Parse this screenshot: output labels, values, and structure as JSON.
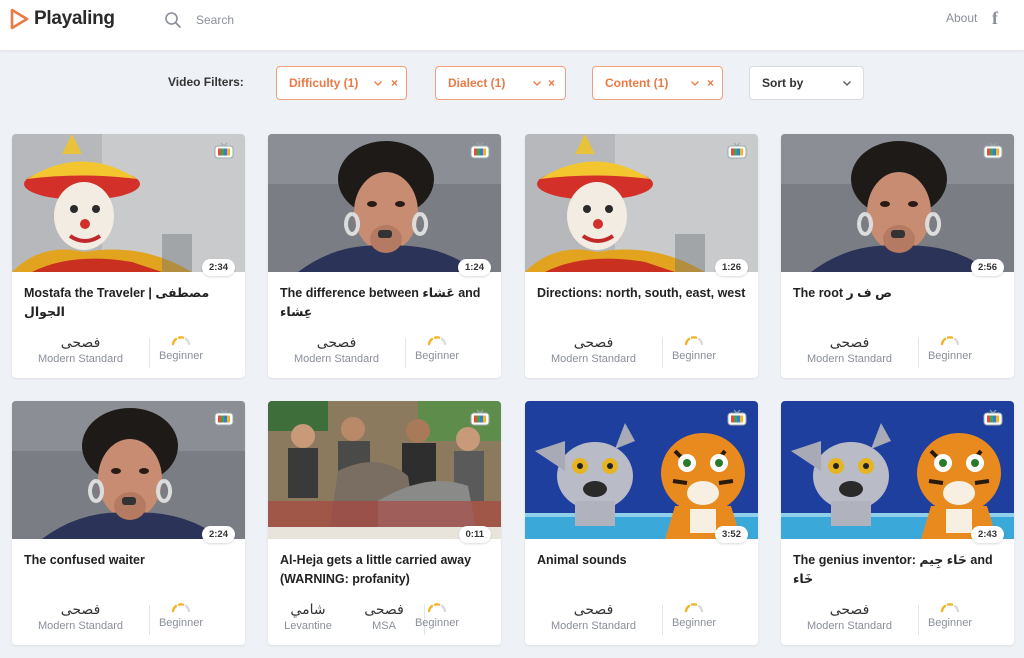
{
  "header": {
    "brand": "Playaling",
    "search_placeholder": "Search",
    "about_label": "About",
    "facebook_icon": "f"
  },
  "filters": {
    "label": "Video Filters:",
    "difficulty": "Difficulty (1)",
    "dialect": "Dialect (1)",
    "content": "Content (1)",
    "sort": "Sort by",
    "clear_glyph": "×"
  },
  "colors": {
    "accent": "#e97a45",
    "background": "#eef1f6"
  },
  "videos": [
    {
      "title": "Mostafa the Traveler | مصطفى الجوال",
      "duration": "2:34",
      "thumbnail": "clown",
      "dialects": [
        {
          "ar": "فصحى",
          "en": "Modern Standard"
        }
      ],
      "level": "Beginner"
    },
    {
      "title": "The difference between عَشاء and عِشاء",
      "duration": "1:24",
      "thumbnail": "woman",
      "dialects": [
        {
          "ar": "فصحى",
          "en": "Modern Standard"
        }
      ],
      "level": "Beginner"
    },
    {
      "title": "Directions: north, south, east, west",
      "duration": "1:26",
      "thumbnail": "clown",
      "dialects": [
        {
          "ar": "فصحى",
          "en": "Modern Standard"
        }
      ],
      "level": "Beginner"
    },
    {
      "title": "The root ص ف ر",
      "duration": "2:56",
      "thumbnail": "woman",
      "dialects": [
        {
          "ar": "فصحى",
          "en": "Modern Standard"
        }
      ],
      "level": "Beginner"
    },
    {
      "title": "The confused waiter",
      "duration": "2:24",
      "thumbnail": "woman",
      "dialects": [
        {
          "ar": "فصحى",
          "en": "Modern Standard"
        }
      ],
      "level": "Beginner"
    },
    {
      "title": "Al-Heja gets a little carried away (WARNING: profanity)",
      "duration": "0:11",
      "thumbnail": "crowd",
      "dialects": [
        {
          "ar": "شامي",
          "en": "Levantine"
        },
        {
          "ar": "فصحى",
          "en": "MSA"
        }
      ],
      "level": "Beginner"
    },
    {
      "title": "Animal sounds",
      "duration": "3:52",
      "thumbnail": "puppets",
      "dialects": [
        {
          "ar": "فصحى",
          "en": "Modern Standard"
        }
      ],
      "level": "Beginner"
    },
    {
      "title": "The genius inventor: حَاء جِيم and خَاء",
      "duration": "2:43",
      "thumbnail": "puppets",
      "dialects": [
        {
          "ar": "فصحى",
          "en": "Modern Standard"
        }
      ],
      "level": "Beginner"
    }
  ]
}
